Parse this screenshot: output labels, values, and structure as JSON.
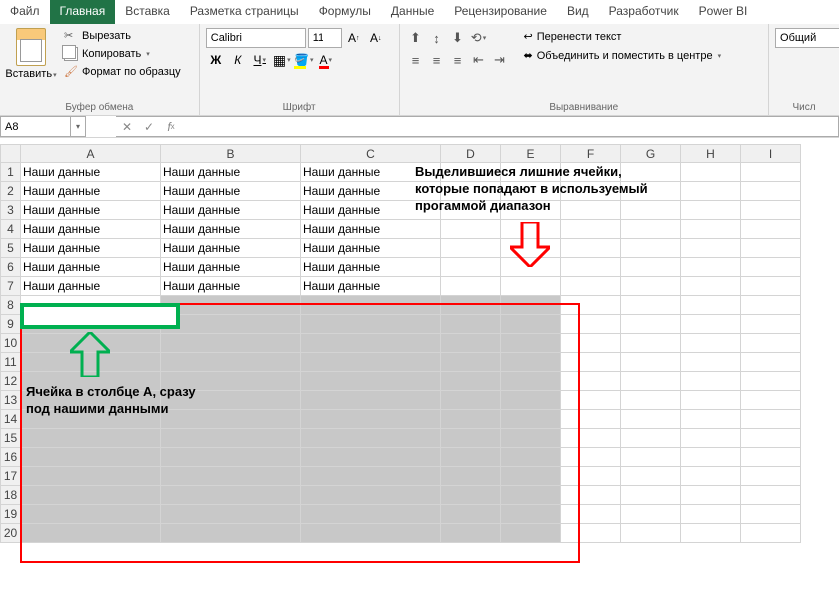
{
  "tabs": [
    "Файл",
    "Главная",
    "Вставка",
    "Разметка страницы",
    "Формулы",
    "Данные",
    "Рецензирование",
    "Вид",
    "Разработчик",
    "Power BI"
  ],
  "activeTab": 1,
  "ribbon": {
    "clipboard": {
      "paste": "Вставить",
      "cut": "Вырезать",
      "copy": "Копировать",
      "format": "Формат по образцу",
      "label": "Буфер обмена"
    },
    "font": {
      "name": "Calibri",
      "size": "11",
      "bold": "Ж",
      "italic": "К",
      "underline": "Ч",
      "label": "Шрифт"
    },
    "alignment": {
      "wrap": "Перенести текст",
      "merge": "Объединить и поместить в центре",
      "label": "Выравнивание"
    },
    "number": {
      "format": "Общий",
      "label": "Числ"
    }
  },
  "nameBox": "A8",
  "formula": "",
  "columns": [
    "A",
    "B",
    "C",
    "D",
    "E",
    "F",
    "G",
    "H",
    "I"
  ],
  "rows": [
    1,
    2,
    3,
    4,
    5,
    6,
    7,
    8,
    9,
    10,
    11,
    12,
    13,
    14,
    15,
    16,
    17,
    18,
    19,
    20
  ],
  "cellText": "Наши данные",
  "dataRows": 7,
  "dataCols": 3,
  "selectionStart": {
    "row": 8,
    "col": 1
  },
  "selectionEnd": {
    "row": 20,
    "col": 5
  },
  "activeCell": {
    "row": 8,
    "col": 1
  },
  "annotations": {
    "topRight": "Выделившиеся лишние ячейки, которые попадают в используемый прогаммой диапазон",
    "bottomLeft": "Ячейка в столбце А, сразу под нашими данными"
  }
}
